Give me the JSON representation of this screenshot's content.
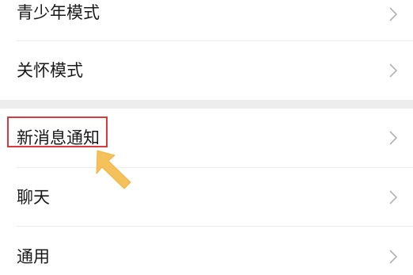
{
  "settings": {
    "items": [
      {
        "label": "青少年模式"
      },
      {
        "label": "关怀模式"
      },
      {
        "label": "新消息通知"
      },
      {
        "label": "聊天"
      },
      {
        "label": "通用"
      }
    ]
  },
  "colors": {
    "highlight": "#d93a3e",
    "arrow": "#f5c15a",
    "group_gap": "#ededed"
  },
  "icons": {
    "chevron": "chevron-right-icon",
    "annotation": "pointing-arrow-icon"
  }
}
